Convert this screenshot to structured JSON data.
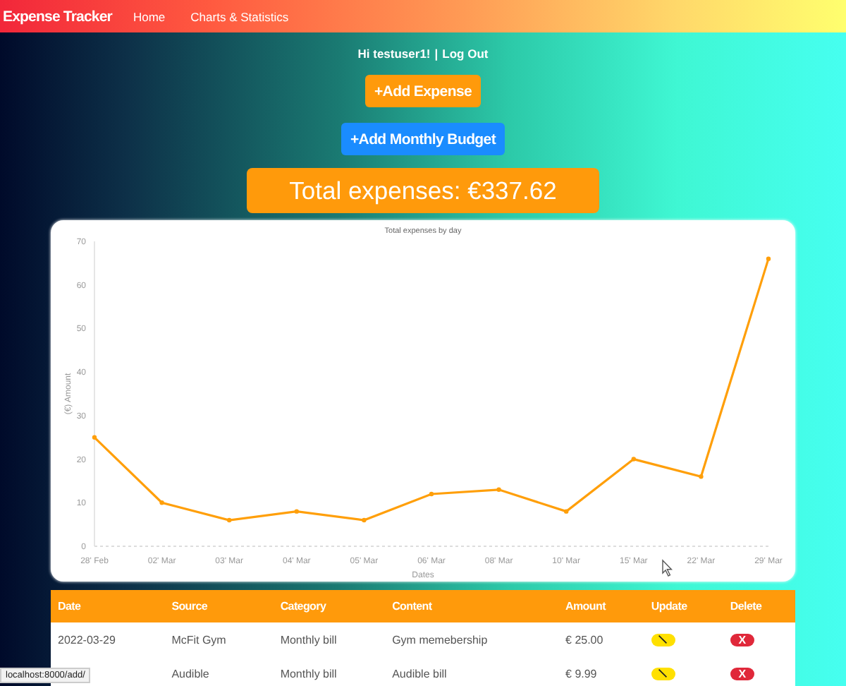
{
  "navbar": {
    "brand": "Expense Tracker",
    "links": [
      {
        "label": "Home",
        "selected": false
      },
      {
        "label": "Charts & Statistics",
        "selected": false
      }
    ]
  },
  "greeting": {
    "text": "Hi testuser1!",
    "separator": "|",
    "logout": "Log Out"
  },
  "buttons": [
    {
      "kind": "expense",
      "label": "+Add Expense"
    },
    {
      "kind": "budget",
      "label": "+Add Monthly Budget"
    }
  ],
  "total": "Total expenses: €337.62",
  "chart": {
    "chart_data": {
      "type": "line",
      "title": "Total expenses by day",
      "xlabel": "Dates",
      "ylabel": "(€) Amount",
      "categories": [
        "28' Feb",
        "02' Mar",
        "03' Mar",
        "04' Mar",
        "05' Mar",
        "06' Mar",
        "08' Mar",
        "10' Mar",
        "15' Mar",
        "22' Mar",
        "29' Mar"
      ],
      "series": [
        {
          "color": "#ff9f0a",
          "marker": true,
          "values": [
            25,
            10,
            6,
            8,
            6,
            12,
            13,
            8,
            20,
            16,
            66
          ]
        }
      ],
      "ylim": [
        0,
        70
      ],
      "yticks": [
        0,
        10,
        20,
        30,
        40,
        50,
        60,
        70
      ]
    }
  },
  "table": {
    "columns": [
      "Date",
      "Source",
      "Category",
      "Content",
      "Amount",
      "Update",
      "Delete"
    ],
    "rows": [
      {
        "date": "2022-03-29",
        "source": "McFit Gym",
        "category": "Monthly bill",
        "content": "Gym memebership",
        "amount": "€ 25.00",
        "delete": "X"
      },
      {
        "source": "Audible",
        "category": "Monthly bill",
        "content": "Audible bill",
        "amount": "€ 9.99",
        "delete": "X"
      }
    ]
  },
  "status_bar": "localhost:8000/add/"
}
